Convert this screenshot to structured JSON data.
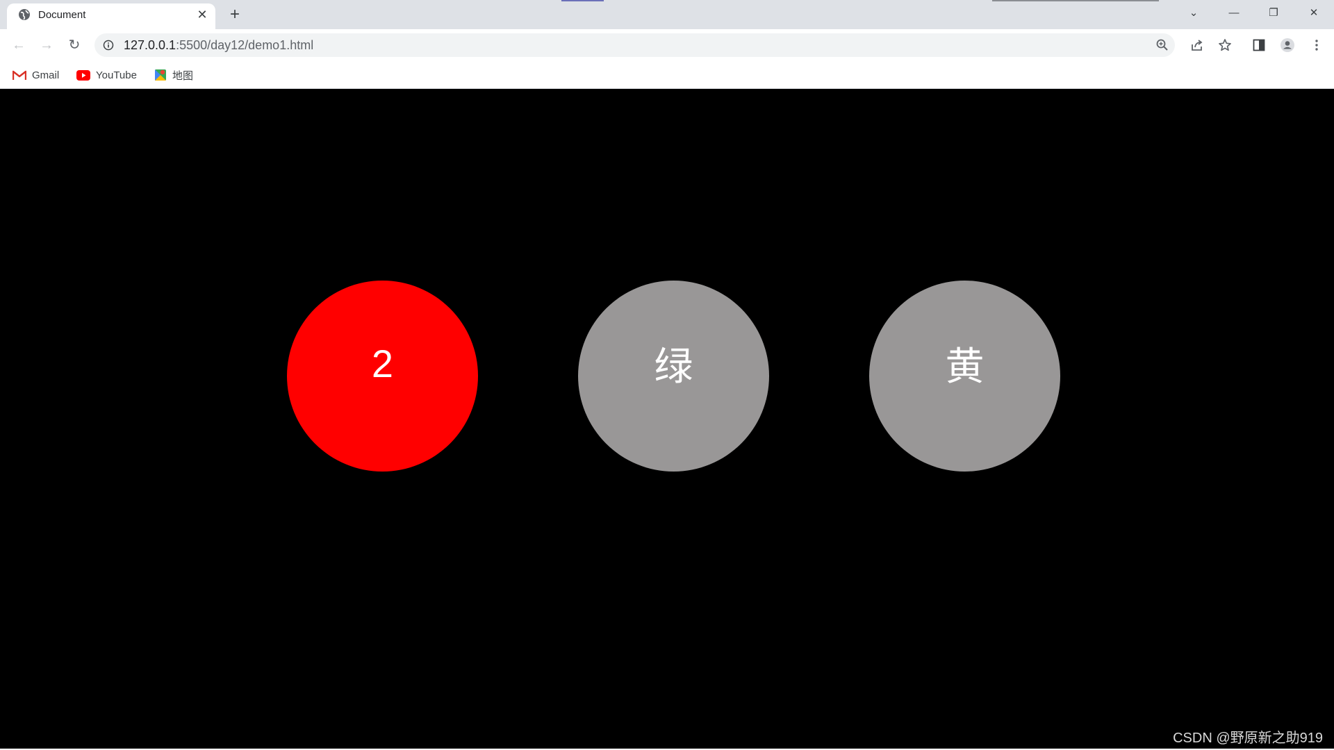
{
  "tab": {
    "title": "Document",
    "close_glyph": "✕"
  },
  "new_tab_glyph": "+",
  "window_controls": {
    "tab_search": "⌄",
    "minimize": "—",
    "maximize": "❐",
    "close": "✕"
  },
  "nav": {
    "back": "←",
    "forward": "→",
    "reload": "↻"
  },
  "address": {
    "host": "127.0.0.1",
    "path": ":5500/day12/demo1.html"
  },
  "bookmarks": [
    {
      "label": "Gmail",
      "icon": "gmail-icon"
    },
    {
      "label": "YouTube",
      "icon": "youtube-icon"
    },
    {
      "label": "地图",
      "icon": "maps-icon"
    }
  ],
  "lights": [
    {
      "label": "2",
      "color": "#ff0000"
    },
    {
      "label": "绿",
      "color": "#999797"
    },
    {
      "label": "黄",
      "color": "#999797"
    }
  ],
  "watermark": "CSDN @野原新之助919",
  "colors": {
    "page_bg": "#000000",
    "active": "#ff0000",
    "inactive": "#999797"
  }
}
